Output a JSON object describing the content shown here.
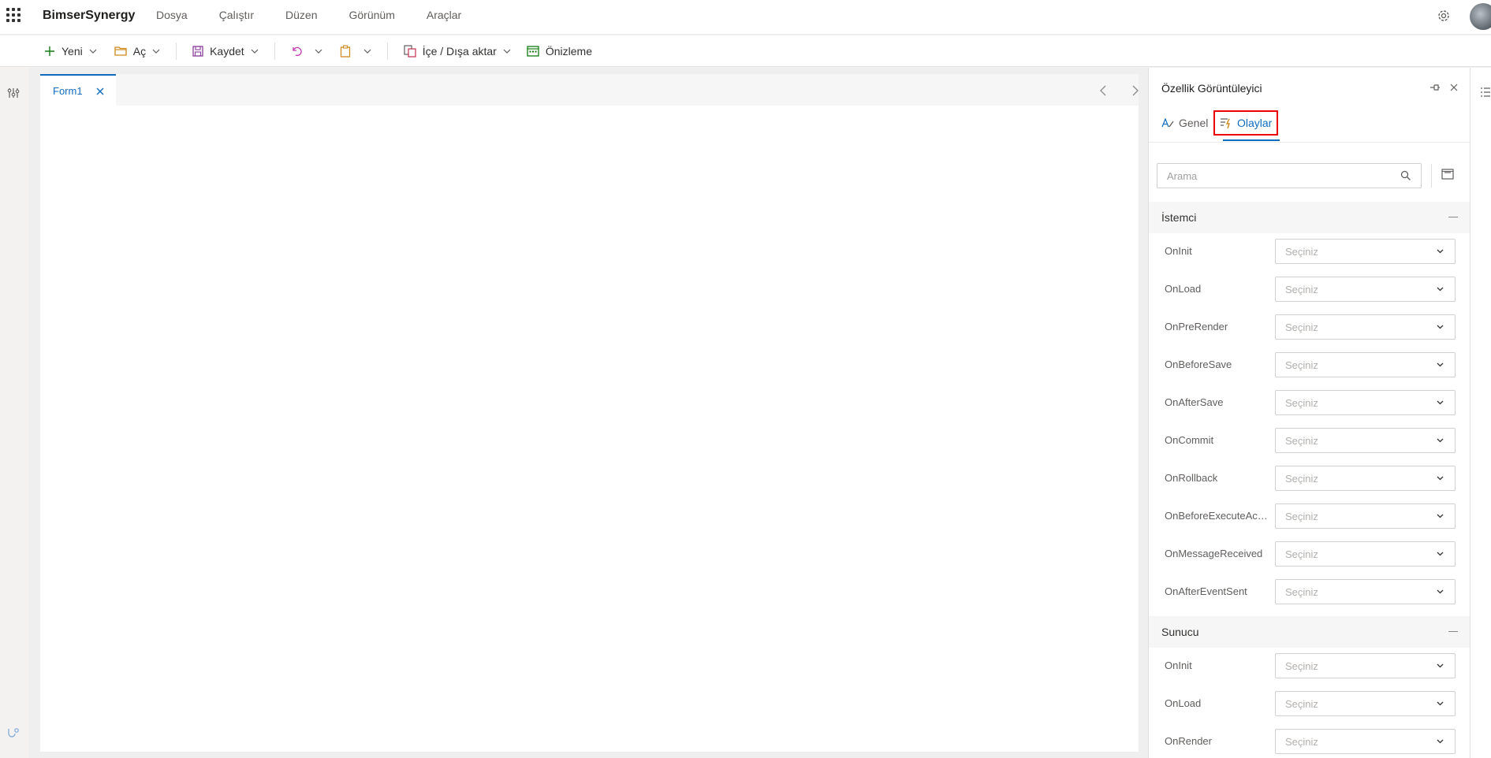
{
  "app": {
    "brand": "BimserSynergy",
    "menu": [
      "Dosya",
      "Çalıştır",
      "Düzen",
      "Görünüm",
      "Araçlar"
    ]
  },
  "toolbar": {
    "new_label": "Yeni",
    "open_label": "Aç",
    "save_label": "Kaydet",
    "import_export_label": "İçe / Dışa aktar",
    "preview_label": "Önizleme"
  },
  "document": {
    "tab_label": "Form1"
  },
  "panel": {
    "title": "Özellik Görüntüleyici",
    "tabs": {
      "general": "Genel",
      "events": "Olaylar"
    },
    "search_placeholder": "Arama",
    "sections": [
      {
        "label": "İstemci",
        "events": [
          {
            "name": "OnInit",
            "value": "Seçiniz"
          },
          {
            "name": "OnLoad",
            "value": "Seçiniz"
          },
          {
            "name": "OnPreRender",
            "value": "Seçiniz"
          },
          {
            "name": "OnBeforeSave",
            "value": "Seçiniz"
          },
          {
            "name": "OnAfterSave",
            "value": "Seçiniz"
          },
          {
            "name": "OnCommit",
            "value": "Seçiniz"
          },
          {
            "name": "OnRollback",
            "value": "Seçiniz"
          },
          {
            "name": "OnBeforeExecuteActi...",
            "value": "Seçiniz"
          },
          {
            "name": "OnMessageReceived",
            "value": "Seçiniz"
          },
          {
            "name": "OnAfterEventSent",
            "value": "Seçiniz"
          }
        ]
      },
      {
        "label": "Sunucu",
        "events": [
          {
            "name": "OnInit",
            "value": "Seçiniz"
          },
          {
            "name": "OnLoad",
            "value": "Seçiniz"
          },
          {
            "name": "OnRender",
            "value": "Seçiniz"
          }
        ]
      }
    ]
  },
  "colors": {
    "accent": "#0f6cbd",
    "highlight_border": "#e00000"
  }
}
